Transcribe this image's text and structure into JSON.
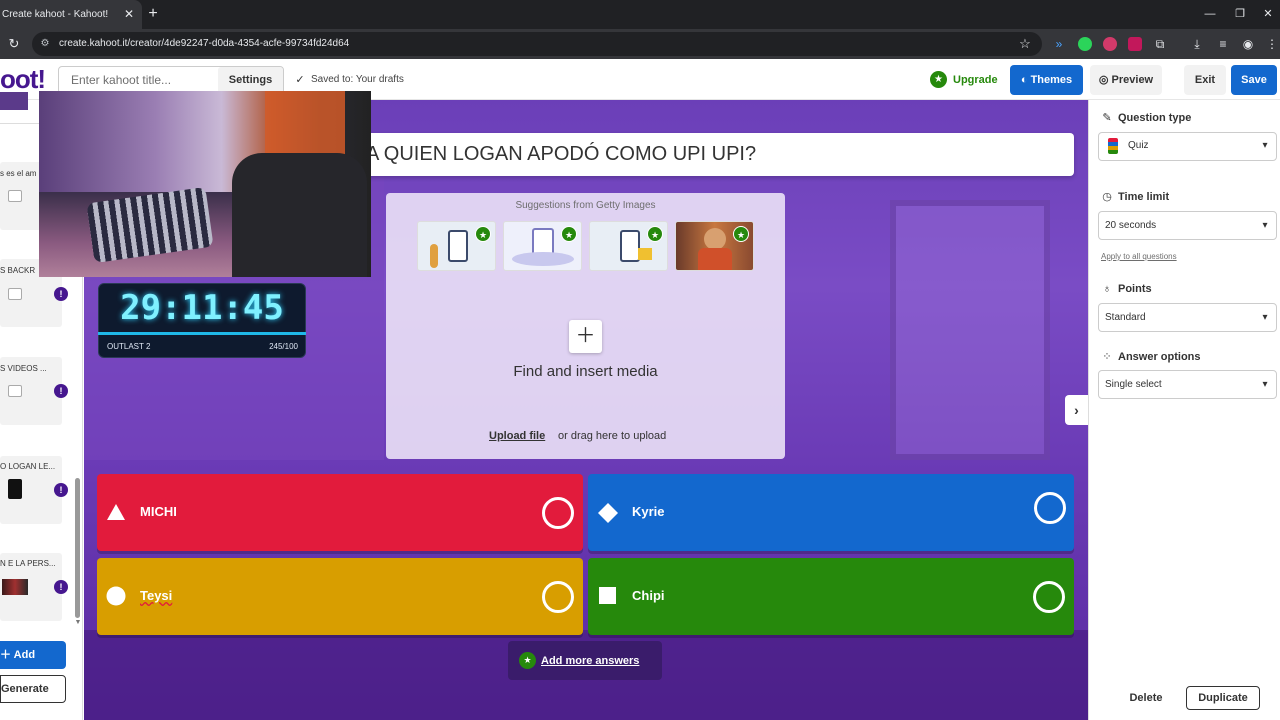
{
  "browser": {
    "tab_title": "Create kahoot - Kahoot!",
    "url": "create.kahoot.it/creator/4de92247-d0da-4354-acfe-99734fd24d64"
  },
  "header": {
    "logo": "oot!",
    "title_placeholder": "Enter kahoot title...",
    "settings_label": "Settings",
    "saved_text": "Saved to: Your drafts",
    "upgrade_label": "Upgrade",
    "themes_label": "Themes",
    "preview_label": "Preview",
    "exit_label": "Exit",
    "save_label": "Save"
  },
  "sidebar": {
    "slides": [
      {
        "label": "s es el am"
      },
      {
        "label": "S BACKR"
      },
      {
        "label": "S VIDEOS ..."
      },
      {
        "label": "O LOGAN LE..."
      },
      {
        "label": "N E LA PERS..."
      }
    ],
    "warning_symbol": "!",
    "add_label": "Add",
    "generate_label": "Generate"
  },
  "question": {
    "text": "A QUIEN LOGAN APODÓ COMO UPI UPI?"
  },
  "media": {
    "suggestions_title": "Suggestions from Getty Images",
    "find_label": "Find and insert media",
    "upload_label": "Upload file",
    "drag_label": "or drag here to upload"
  },
  "answers": [
    {
      "label": "MICHI",
      "color": "#e21b3c",
      "shape": "triangle"
    },
    {
      "label": "Kyrie",
      "color": "#1368ce",
      "shape": "diamond"
    },
    {
      "label": "Teysi",
      "color": "#d89e00",
      "shape": "circle"
    },
    {
      "label": "Chipi",
      "color": "#26890c",
      "shape": "square"
    }
  ],
  "add_more_label": "Add more answers",
  "overlay": {
    "timer": "29:11:45",
    "game": "OUTLAST 2",
    "count": "245/100"
  },
  "right_panel": {
    "question_type_label": "Question type",
    "question_type_value": "Quiz",
    "time_limit_label": "Time limit",
    "time_limit_value": "20 seconds",
    "apply_all_label": "Apply to all questions",
    "points_label": "Points",
    "points_value": "Standard",
    "answer_options_label": "Answer options",
    "answer_options_value": "Single select",
    "delete_label": "Delete",
    "duplicate_label": "Duplicate"
  }
}
